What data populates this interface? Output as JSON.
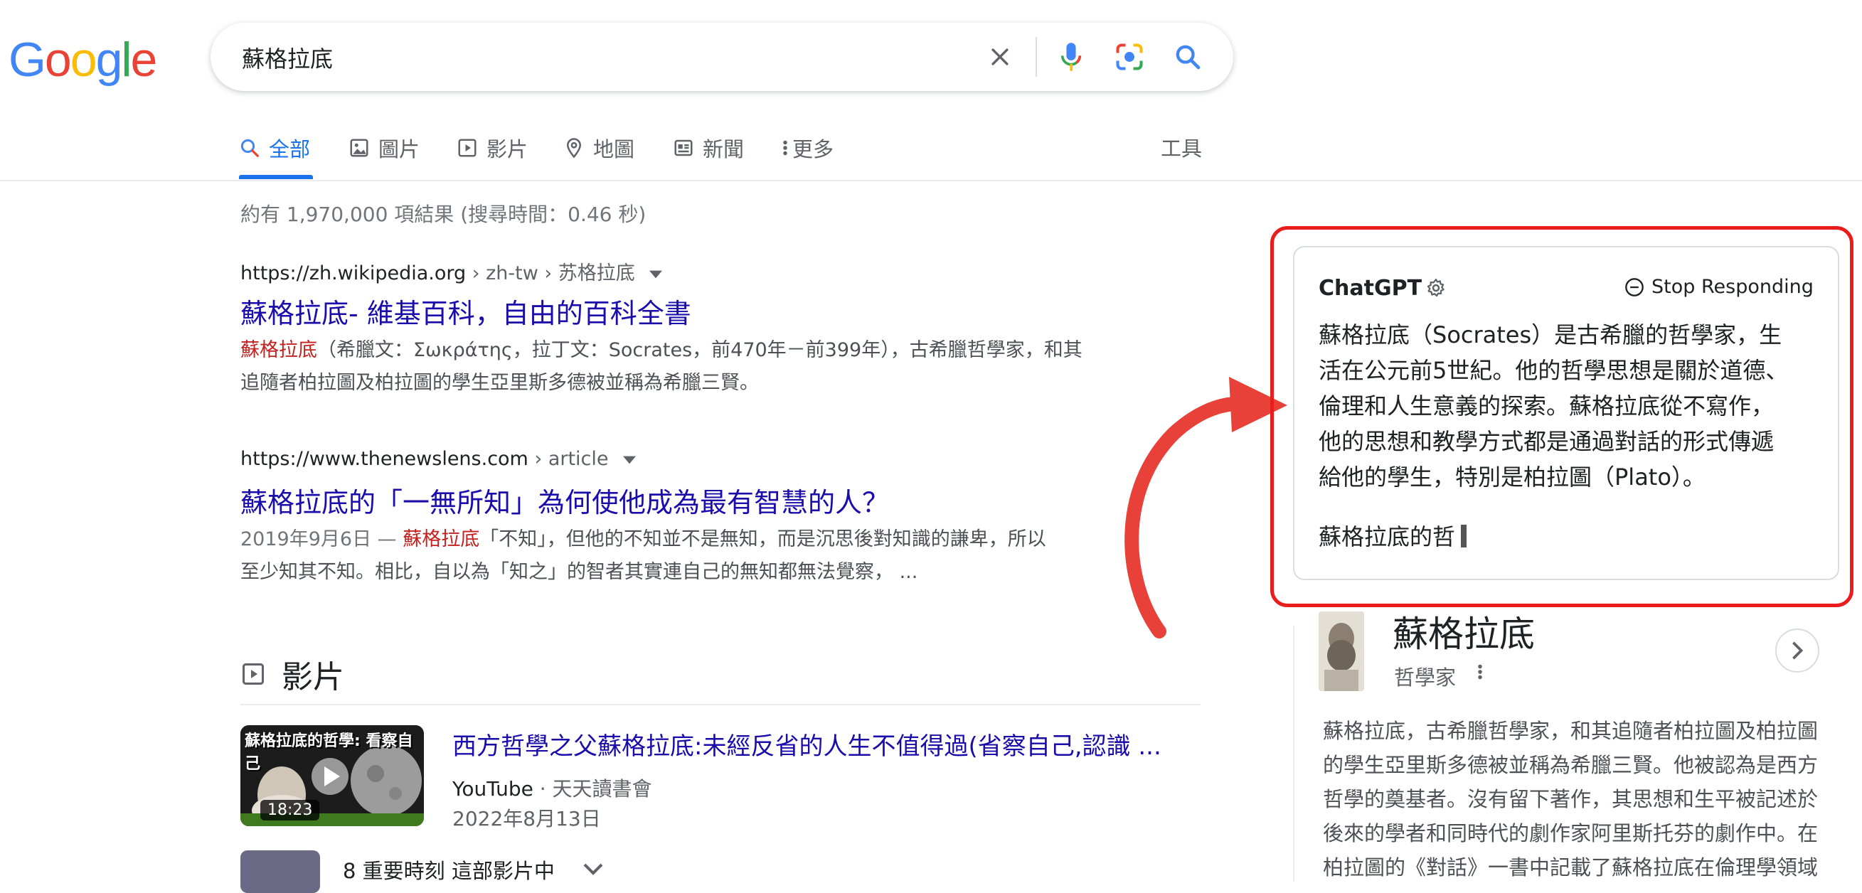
{
  "logo": {
    "letters": [
      "G",
      "o",
      "o",
      "g",
      "l",
      "e"
    ]
  },
  "search": {
    "query": "蘇格拉底"
  },
  "tabs": [
    {
      "label": "全部"
    },
    {
      "label": "圖片"
    },
    {
      "label": "影片"
    },
    {
      "label": "地圖"
    },
    {
      "label": "新聞"
    },
    {
      "label": "更多"
    }
  ],
  "tools_label": "工具",
  "result_stats": "約有 1,970,000 項結果 (搜尋時間：0.46 秒)",
  "results": [
    {
      "cite_host": "https://zh.wikipedia.org",
      "cite_path": " › zh-tw › 苏格拉底",
      "title": "蘇格拉底- 維基百科，自由的百科全書",
      "snippet_em": "蘇格拉底",
      "snippet_line1": "（希臘文：Σωκράτης，拉丁文：Socrates，前470年－前399年），古希臘哲學家，和其",
      "snippet_line2": "追隨者柏拉圖及柏拉圖的學生亞里斯多德被並稱為希臘三賢。"
    },
    {
      "cite_host": "https://www.thenewslens.com",
      "cite_path": " › article",
      "title": "蘇格拉底的「一無所知」為何使他成為最有智慧的人？",
      "snippet_date": "2019年9月6日 — ",
      "snippet_em": "蘇格拉底",
      "snippet_line1": "「不知」，但他的不知並不是無知，而是沉思後對知識的謙卑，所以",
      "snippet_line2": "至少知其不知。相比，自以為「知之」的智者其實連自己的無知都無法覺察， ..."
    }
  ],
  "video": {
    "heading": "影片",
    "thumb_text": "蘇格拉底的哲學: 看察自己",
    "duration": "18:23",
    "title": "西方哲學之父蘇格拉底:未經反省的人生不值得過(省察自己,認識 ...",
    "source": "YouTube",
    "channel": " · 天天讀書會",
    "date": "2022年8月13日",
    "moments": "8 重要時刻  這部影片中"
  },
  "chatgpt": {
    "title": "ChatGPT",
    "stop_label": "Stop Responding",
    "body_lines": [
      "蘇格拉底（Socrates）是古希臘的哲學家，生",
      "活在公元前5世紀。他的哲學思想是關於道德、",
      "倫理和人生意義的探索。蘇格拉底從不寫作，",
      "他的思想和教學方式都是通過對話的形式傳遞",
      "給他的學生，特別是柏拉圖（Plato）。"
    ],
    "partial": "蘇格拉底的哲"
  },
  "knowledge_panel": {
    "title": "蘇格拉底",
    "subtitle": "哲學家",
    "description_lines": [
      "蘇格拉底，古希臘哲學家，和其追隨者柏拉圖及柏拉圖",
      "的學生亞里斯多德被並稱為希臘三賢。他被認為是西方",
      "哲學的奠基者。沒有留下著作，其思想和生平被記述於",
      "後來的學者和同時代的劇作家阿里斯托芬的劇作中。在",
      "柏拉圖的《對話》一書中記載了蘇格拉底在倫理學領域"
    ]
  },
  "colors": {
    "link": "#1a0dab",
    "accent": "#1a73e8",
    "highlight": "#c5221f",
    "annotation_red": "#ea1d1d"
  }
}
